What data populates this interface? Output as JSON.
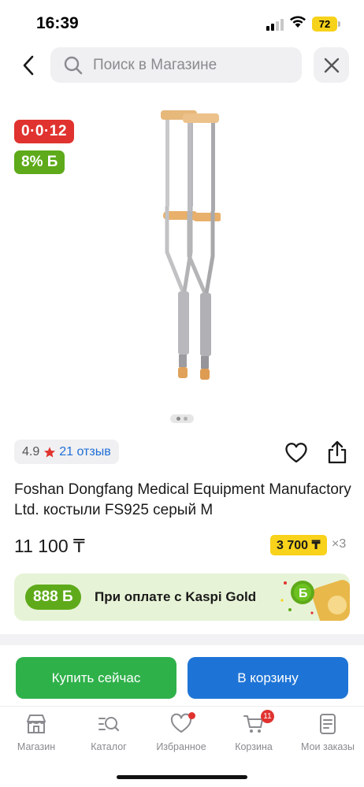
{
  "status_bar": {
    "time": "16:39",
    "battery": "72"
  },
  "header": {
    "back_icon": "chevron-left-icon",
    "search_placeholder": "Поиск в Магазине",
    "search_value": "",
    "search_icon": "search-icon",
    "close_icon": "close-icon"
  },
  "product": {
    "image_icon": "crutches-image",
    "badges": {
      "installment": "0·0·12",
      "bonus": "8% Б"
    },
    "gallery": {
      "pages": 2,
      "current": 1
    },
    "rating": "4.9",
    "reviews": "21 отзыв",
    "title": "Foshan Dongfang Medical Equipment Manufactory Ltd. костыли FS925 серый M",
    "price": "11 100 ₸",
    "installment_price": "3 700 ₸",
    "installment_times": "×3"
  },
  "kaspi_gold": {
    "bonus": "888 Б",
    "text": "При оплате с Kaspi Gold"
  },
  "actions": {
    "buy_now": "Купить сейчас",
    "add_to_cart": "В корзину"
  },
  "tabs": [
    {
      "label": "Магазин",
      "icon": "store-icon"
    },
    {
      "label": "Каталог",
      "icon": "catalog-icon"
    },
    {
      "label": "Избранное",
      "icon": "heart-icon",
      "dot": true
    },
    {
      "label": "Корзина",
      "icon": "cart-icon",
      "count": "11"
    },
    {
      "label": "Мои заказы",
      "icon": "orders-icon"
    }
  ],
  "colors": {
    "red_badge": "#e0332f",
    "green_badge": "#5eaa1a",
    "yellow": "#f8d21b",
    "buy_green": "#2fb14a",
    "cart_blue": "#1e74d6",
    "link_blue": "#1f6fd6"
  }
}
